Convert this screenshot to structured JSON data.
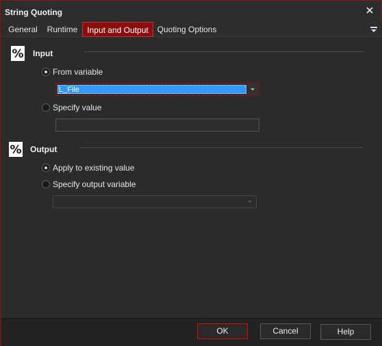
{
  "window": {
    "title": "String Quoting"
  },
  "tabs": [
    {
      "label": "General"
    },
    {
      "label": "Runtime"
    },
    {
      "label": "Input and Output",
      "active": true
    },
    {
      "label": "Quoting Options"
    }
  ],
  "input_section": {
    "title": "Input",
    "icon": "percent-icon",
    "from_variable_label": "From variable",
    "from_variable_selected": true,
    "from_variable_value": "L_File",
    "specify_value_label": "Specify value",
    "specify_value_selected": false,
    "specify_value_value": ""
  },
  "output_section": {
    "title": "Output",
    "icon": "percent-icon",
    "apply_existing_label": "Apply to existing value",
    "apply_existing_selected": true,
    "specify_output_label": "Specify output variable",
    "specify_output_selected": false,
    "output_variable_value": ""
  },
  "buttons": {
    "ok": "OK",
    "cancel": "Cancel",
    "help": "Help"
  },
  "colors": {
    "accent": "#8b0f0f",
    "selection": "#3399ff",
    "background": "#2b2b2b"
  }
}
